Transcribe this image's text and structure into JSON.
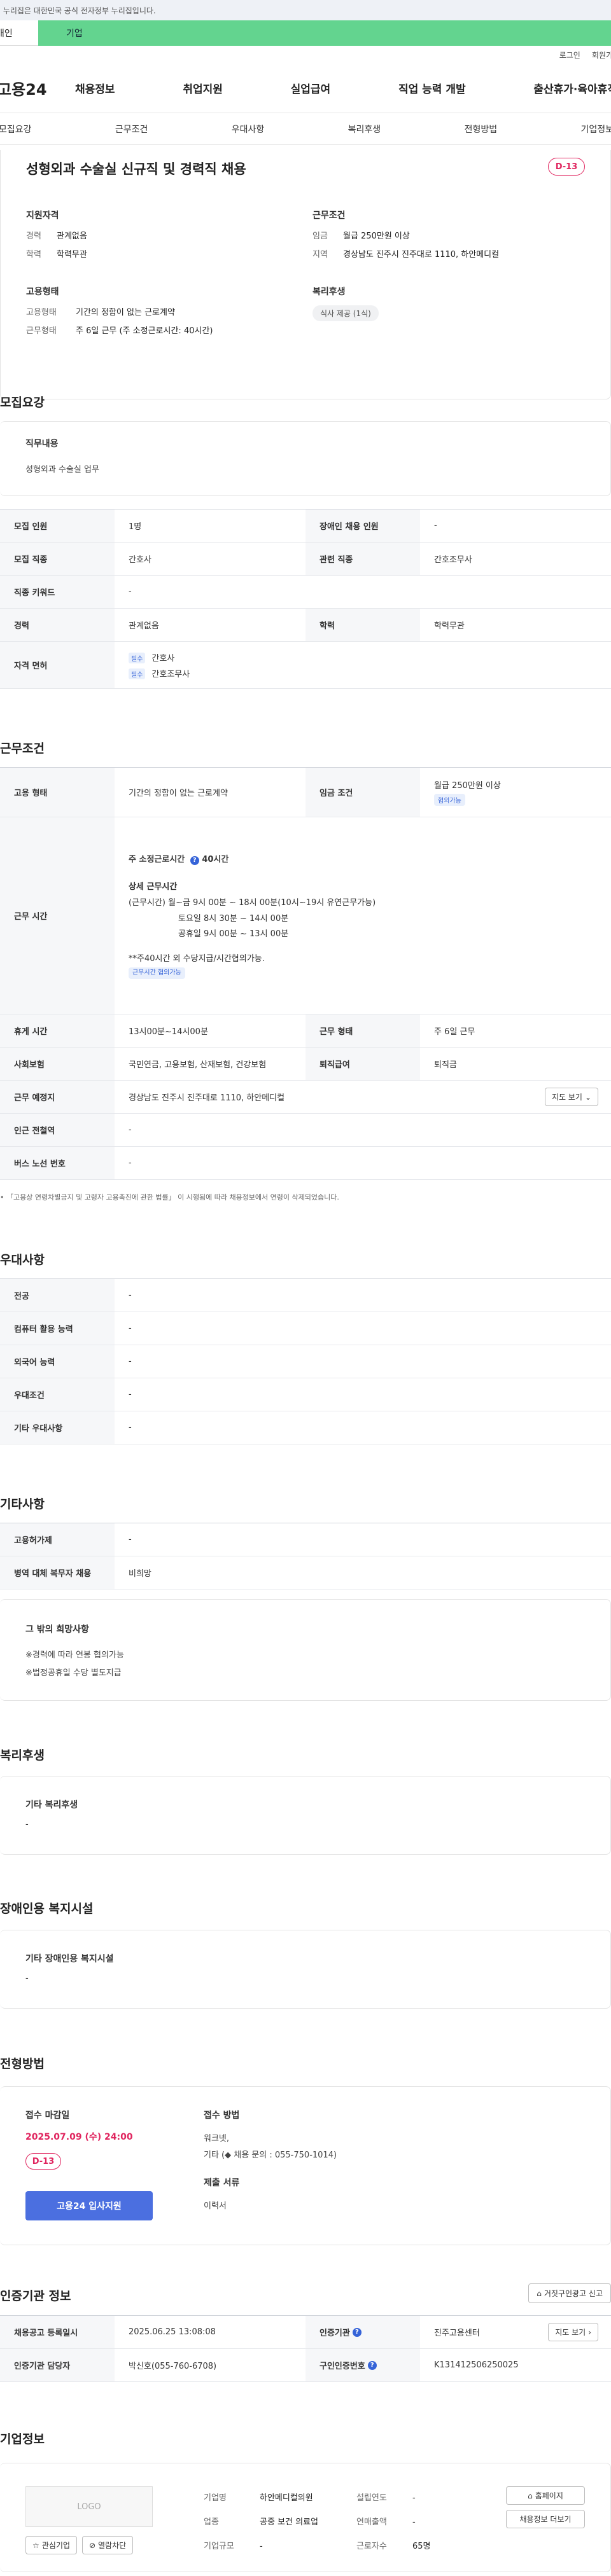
{
  "topbar": {
    "text": "이 누리집은 대한민국 공식 전자정부 누리집입니다."
  },
  "tabs": {
    "personal": "개인",
    "company": "기업"
  },
  "util": {
    "login": "로그인",
    "join": "회원가입"
  },
  "gnb": {
    "logo": "고용24",
    "items": [
      "채용정보",
      "취업지원",
      "실업급여",
      "직업 능력 개발",
      "출산휴가·육아휴직"
    ]
  },
  "subnav": [
    "모집요강",
    "근무조건",
    "우대사항",
    "복리후생",
    "전형방법",
    "기업정보"
  ],
  "summary": {
    "title": "성형외과 수술실 신규직 및 경력직 채용",
    "dday": "D-13",
    "qual": {
      "title": "지원자격",
      "rows": [
        {
          "label": "경력",
          "value": "관계없음"
        },
        {
          "label": "학력",
          "value": "학력무관"
        }
      ]
    },
    "cond": {
      "title": "근무조건",
      "rows": [
        {
          "label": "임금",
          "value": "월급 250만원 이상"
        },
        {
          "label": "지역",
          "value": "경상남도 진주시 진주대로 1110, 하안메디컬"
        }
      ]
    },
    "emp": {
      "title": "고용형태",
      "rows": [
        {
          "label": "고용형태",
          "value": "기간의 정함이 없는 근로계약"
        },
        {
          "label": "근무형태",
          "value": "주 6일 근무 (주 소정근로시간: 40시간)"
        }
      ]
    },
    "welfare": {
      "title": "복리후생",
      "pill": "식사 제공 (1식)"
    }
  },
  "recruit": {
    "title": "모집요강",
    "job_title": "직무내용",
    "job_value": "성형외과 수술실 업무",
    "rows": {
      "count_label": "모집 인원",
      "count_value": "1명",
      "disabled_label": "장애인 채용 인원",
      "disabled_value": "-",
      "job_label": "모집 직종",
      "job_value": "간호사",
      "related_label": "관련 직종",
      "related_value": "간호조무사",
      "keyword_label": "직종 키워드",
      "keyword_value": "-",
      "career_label": "경력",
      "career_value": "관계없음",
      "edu_label": "학력",
      "edu_value": "학력무관",
      "license_label": "자격 면허",
      "license_badge": "필수",
      "license1": "간호사",
      "license2": "간호조무사"
    }
  },
  "work": {
    "title": "근무조건",
    "type_label": "고용 형태",
    "type_value": "기간의 정함이 없는 근로계약",
    "wage_label": "임금 조건",
    "wage_value": "월급 250만원 이상",
    "wage_badge": "협의가능",
    "hours_label": "근무 시간",
    "hours_main": "주 소정근로시간",
    "hours_total": "40시간",
    "hours_detail_title": "상세 근무시간",
    "hours_line1": "(근무시간)    월~금  9시 00분 ~ 18시 00분(10시~19시 유연근무가능)",
    "hours_line2": "토요일  8시 30분 ~ 14시 00분",
    "hours_line3": "공휴일  9시 00분 ~ 13시 00분",
    "hours_line4": "**주40시간 외 수당지급/시간협의가능.",
    "hours_badge": "근무시간 협의가능",
    "break_label": "휴게 시간",
    "break_value": "13시00분~14시00분",
    "form_label": "근무 형태",
    "form_value": "주 6일 근무",
    "ins_label": "사회보험",
    "ins_value": "국민연금, 고용보험, 산재보험, 건강보험",
    "ret_label": "퇴직급여",
    "ret_value": "퇴직금",
    "place_label": "근무 예정지",
    "place_value": "경상남도 진주시 진주대로 1110, 하안메디컬",
    "map_btn": "지도 보기",
    "subway_label": "인근 전철역",
    "subway_value": "-",
    "bus_label": "버스 노선 번호",
    "bus_value": "-",
    "note": "「고용상 연령차별금지 및 고령자 고용촉진에 관한 법률」 이 시행됨에 따라 채용정보에서 연령이 삭제되었습니다."
  },
  "pref": {
    "title": "우대사항",
    "rows": [
      {
        "label": "전공",
        "value": "-"
      },
      {
        "label": "컴퓨터 활용 능력",
        "value": "-"
      },
      {
        "label": "외국어 능력",
        "value": "-"
      },
      {
        "label": "우대조건",
        "value": "-"
      },
      {
        "label": "기타 우대사항",
        "value": "-"
      }
    ]
  },
  "etc": {
    "title": "기타사항",
    "rows": [
      {
        "label": "고용허가제",
        "value": "-"
      },
      {
        "label": "병역 대체 복무자 채용",
        "value": "비희망"
      }
    ],
    "other_title": "그 밖의 희망사항",
    "other1": "※경력에 따라 연봉 협의가능",
    "other2": "※법정공휴일 수당 별도지급"
  },
  "welfare": {
    "title": "복리후생",
    "sub": "기타 복리후생",
    "value": "-"
  },
  "facility": {
    "title": "장애인용 복지시설",
    "sub": "기타 장애인용 복지시설",
    "value": "-"
  },
  "process": {
    "title": "전형방법",
    "deadline_title": "접수 마감일",
    "deadline": "2025.07.09 (수) 24:00",
    "dday": "D-13",
    "apply": "고용24 입사지원",
    "method_title": "접수 방법",
    "method1": "워크넷,",
    "method2": "기타 (◆ 채용 문의 : 055-750-1014)",
    "docs_title": "제출 서류",
    "docs_value": "이력서"
  },
  "cert": {
    "title": "인증기관 정보",
    "report_btn": "거짓구인광고 신고",
    "reg_label": "채용공고 등록일시",
    "reg_value": "2025.06.25 13:08:08",
    "org_label": "인증기관",
    "org_value": "진주고용센터",
    "detail_btn": "지도 보기",
    "mgr_label": "인증기관 담당자",
    "mgr_value": "박신호(055-760-6708)",
    "num_label": "구인인증번호",
    "num_value": "K131412506250025"
  },
  "company": {
    "title": "기업정보",
    "logo_text": "LOGO",
    "fav_btn": "관심기업",
    "block_btn": "열람차단",
    "name_label": "기업명",
    "name_value": "하안메디컬의원",
    "biz_label": "업종",
    "biz_value": "공중 보건 의료업",
    "size_label": "기업규모",
    "size_value": "-",
    "year_label": "설립연도",
    "year_value": "-",
    "sales_label": "연매출액",
    "sales_value": "-",
    "emp_label": "근로자수",
    "emp_value": "65명",
    "home_btn": "홈페이지",
    "jobs_btn": "채용정보 더보기"
  }
}
